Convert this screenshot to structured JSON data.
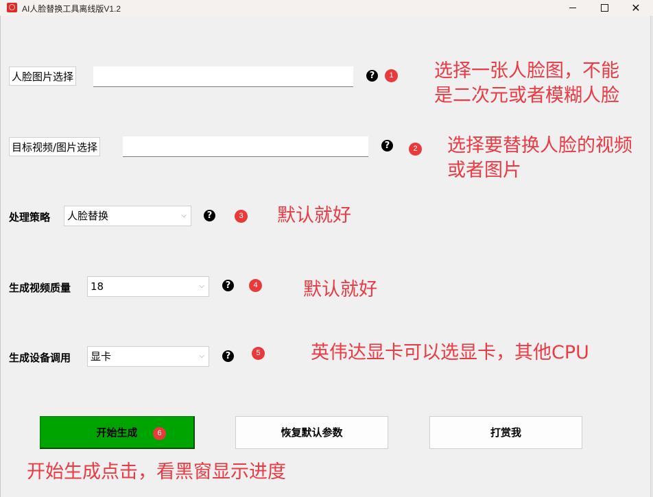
{
  "window": {
    "title": "AI人脸替换工具离线版V1.2",
    "icon": "app-logo-icon",
    "controls": {
      "minimize": "minimize-icon",
      "maximize": "maximize-icon",
      "close": "close-icon"
    }
  },
  "rows": [
    {
      "type": "file",
      "button_label": "人脸图片选择",
      "input_value": "",
      "help": "?",
      "badge": "1",
      "note_lines": [
        "选择一张人脸图，不能",
        "是二次元或者模糊人脸"
      ]
    },
    {
      "type": "file",
      "button_label": "目标视频/图片选择",
      "input_value": "",
      "help": "?",
      "badge": "2",
      "note_lines": [
        "选择要替换人脸的视频",
        "或者图片"
      ]
    },
    {
      "type": "select",
      "label": "处理策略",
      "selected": "人脸替换",
      "help": "?",
      "badge": "3",
      "note_lines": [
        "默认就好"
      ]
    },
    {
      "type": "select",
      "label": "生成视频质量",
      "selected": "18",
      "help": "?",
      "badge": "4",
      "note_lines": [
        "默认就好"
      ]
    },
    {
      "type": "select",
      "label": "生成设备调用",
      "selected": "显卡",
      "help": "?",
      "badge": "5",
      "note_lines": [
        "英伟达显卡可以选显卡，其他CPU"
      ]
    }
  ],
  "actions": {
    "start_label": "开始生成",
    "start_badge": "6",
    "reset_label": "恢复默认参数",
    "tip_label": "打赏我"
  },
  "footer_note": "开始生成点击，看黑窗显示进度",
  "colors": {
    "start_button": "#00a400",
    "annotation": "#ea3a44",
    "badge": "#e8393b"
  }
}
